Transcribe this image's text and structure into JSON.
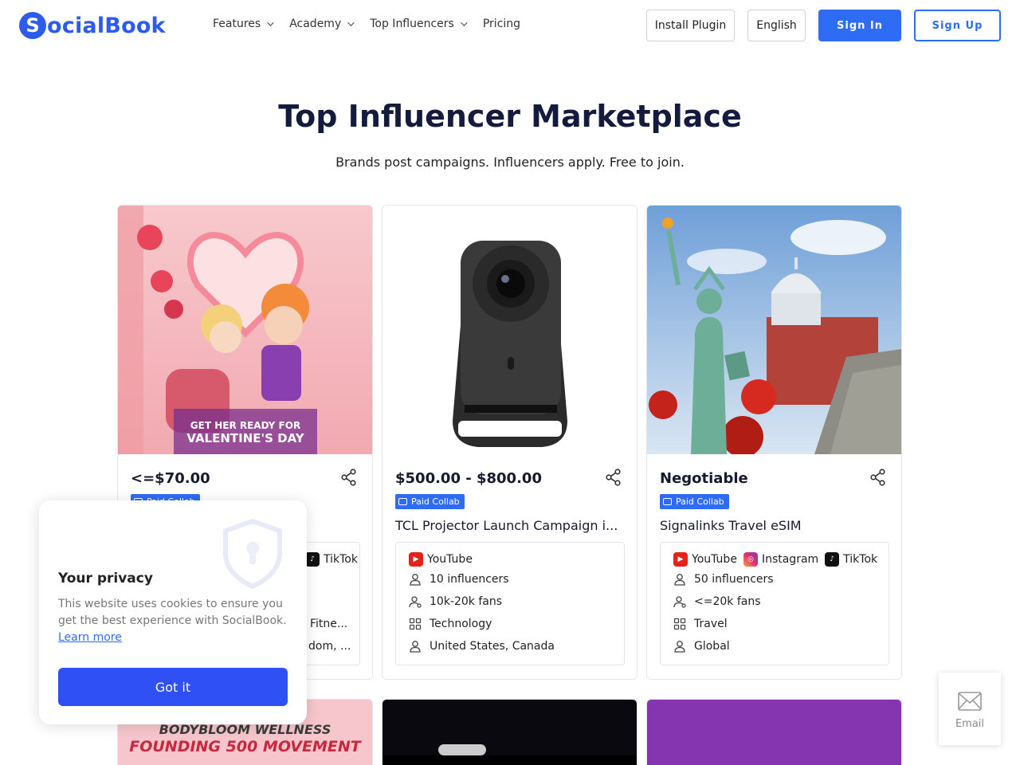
{
  "nav": {
    "logo_mark": "S",
    "logo_text": "ocialBook",
    "menu": [
      {
        "label": "Features",
        "has_dropdown": true
      },
      {
        "label": "Academy",
        "has_dropdown": true
      },
      {
        "label": "Top Influencers",
        "has_dropdown": true
      },
      {
        "label": "Pricing",
        "has_dropdown": false
      }
    ],
    "install_plugin": "Install Plugin",
    "language": "English",
    "sign_in": "Sign In",
    "sign_up": "Sign Up"
  },
  "hero": {
    "title": "Top Influencer Marketplace",
    "subtitle": "Brands post campaigns. Influencers apply. Free to join."
  },
  "cards": [
    {
      "price": "<=$70.00",
      "badge": "Paid Collab",
      "title": "",
      "platforms": [
        "TikTok"
      ],
      "influencers": "",
      "fans": "",
      "category": "Fitne...",
      "region": "dom, ...",
      "image_text_1": "GET HER READY FOR",
      "image_text_2": "VALENTINE'S DAY"
    },
    {
      "price": "$500.00 - $800.00",
      "badge": "Paid Collab",
      "title": "TCL Projector Launch Campaign i...",
      "platforms": [
        "YouTube"
      ],
      "influencers": "10 influencers",
      "fans": "10k-20k fans",
      "category": "Technology",
      "region": "United States, Canada"
    },
    {
      "price": "Negotiable",
      "badge": "Paid Collab",
      "title": "Signalinks Travel eSIM",
      "platforms": [
        "YouTube",
        "Instagram",
        "TikTok"
      ],
      "influencers": "50 influencers",
      "fans": "<=20k fans",
      "category": "Travel",
      "region": "Global"
    }
  ],
  "next_row": {
    "card1_line1": "BODYBLOOM WELLNESS",
    "card1_line2": "FOUNDING 500 MOVEMENT"
  },
  "privacy": {
    "title": "Your privacy",
    "text": "This website uses cookies to ensure you get the best experience with SocialBook.",
    "learn_more": "Learn more",
    "button": "Got it"
  },
  "email_fab": {
    "label": "Email"
  },
  "colors": {
    "brand": "#2f6cf6",
    "title": "#151b3d"
  }
}
